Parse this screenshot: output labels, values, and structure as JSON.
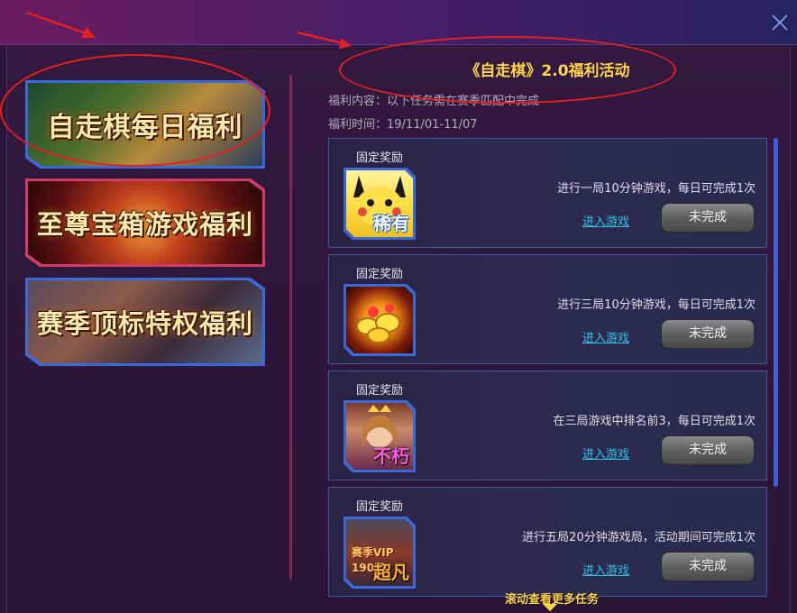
{
  "window": {
    "close_icon": "close-icon",
    "colors": {
      "titlebar_start": "#6b1a5e",
      "titlebar_end": "#26225e",
      "accent_gold": "#ffd54a",
      "link": "#2fc4e6"
    }
  },
  "sidebar": {
    "banners": [
      {
        "label": "自走棋每日福利"
      },
      {
        "label": "至尊宝箱游戏福利"
      },
      {
        "label": "赛季顶标特权福利"
      }
    ]
  },
  "main": {
    "title": "《自走棋》2.0福利活动",
    "content_label": "福利内容：",
    "content_value": "以下任务需在赛季匹配中完成",
    "time_label": "福利时间：",
    "time_value": "19/11/01-11/07",
    "tasks": [
      {
        "reward_label": "固定奖励",
        "reward_tag": "稀有",
        "description": "进行一局10分钟游戏，每日可完成1次",
        "link": "进入游戏",
        "status": "未完成"
      },
      {
        "reward_label": "固定奖励",
        "reward_tag": "",
        "description": "进行三局10分钟游戏，每日可完成1次",
        "link": "进入游戏",
        "status": "未完成"
      },
      {
        "reward_label": "固定奖励",
        "reward_tag": "不朽",
        "description": "在三局游戏中排名前3，每日可完成1次",
        "link": "进入游戏",
        "status": "未完成"
      },
      {
        "reward_label": "固定奖励",
        "reward_tag": "超凡",
        "reward_sub": "赛季VIP 190天",
        "description": "进行五局20分钟游戏局，活动期间可完成1次",
        "link": "进入游戏",
        "status": "未完成"
      }
    ],
    "scroll_hint": "滚动查看更多任务"
  }
}
